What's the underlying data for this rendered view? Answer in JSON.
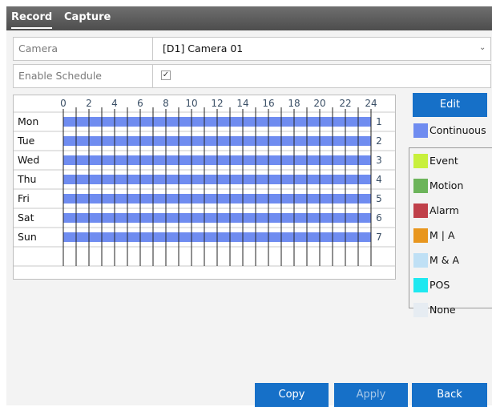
{
  "tabs": [
    {
      "label": "Record",
      "active": true
    },
    {
      "label": "Capture",
      "active": false
    }
  ],
  "camera": {
    "label": "Camera",
    "value": "[D1] Camera 01"
  },
  "enable_schedule": {
    "label": "Enable Schedule",
    "checked": true
  },
  "schedule": {
    "hours": [
      "0",
      "2",
      "4",
      "6",
      "8",
      "10",
      "12",
      "14",
      "16",
      "18",
      "20",
      "22",
      "24"
    ],
    "days": [
      {
        "name": "Mon",
        "index": "1",
        "type": "Continuous"
      },
      {
        "name": "Tue",
        "index": "2",
        "type": "Continuous"
      },
      {
        "name": "Wed",
        "index": "3",
        "type": "Continuous"
      },
      {
        "name": "Thu",
        "index": "4",
        "type": "Continuous"
      },
      {
        "name": "Fri",
        "index": "5",
        "type": "Continuous"
      },
      {
        "name": "Sat",
        "index": "6",
        "type": "Continuous"
      },
      {
        "name": "Sun",
        "index": "7",
        "type": "Continuous"
      }
    ]
  },
  "edit_button": "Edit",
  "legend": [
    {
      "label": "Continuous",
      "color": "#6f8cf0"
    },
    {
      "label": "Event",
      "color": "#c8f03c"
    },
    {
      "label": "Motion",
      "color": "#6cb45a"
    },
    {
      "label": "Alarm",
      "color": "#c0404a"
    },
    {
      "label": "M | A",
      "color": "#e8961e"
    },
    {
      "label": "M & A",
      "color": "#bfe0f5"
    },
    {
      "label": "POS",
      "color": "#1ee8f0"
    },
    {
      "label": "None",
      "color": "#e6ecf2"
    }
  ],
  "footer": {
    "copy": "Copy",
    "apply": "Apply",
    "back": "Back"
  }
}
